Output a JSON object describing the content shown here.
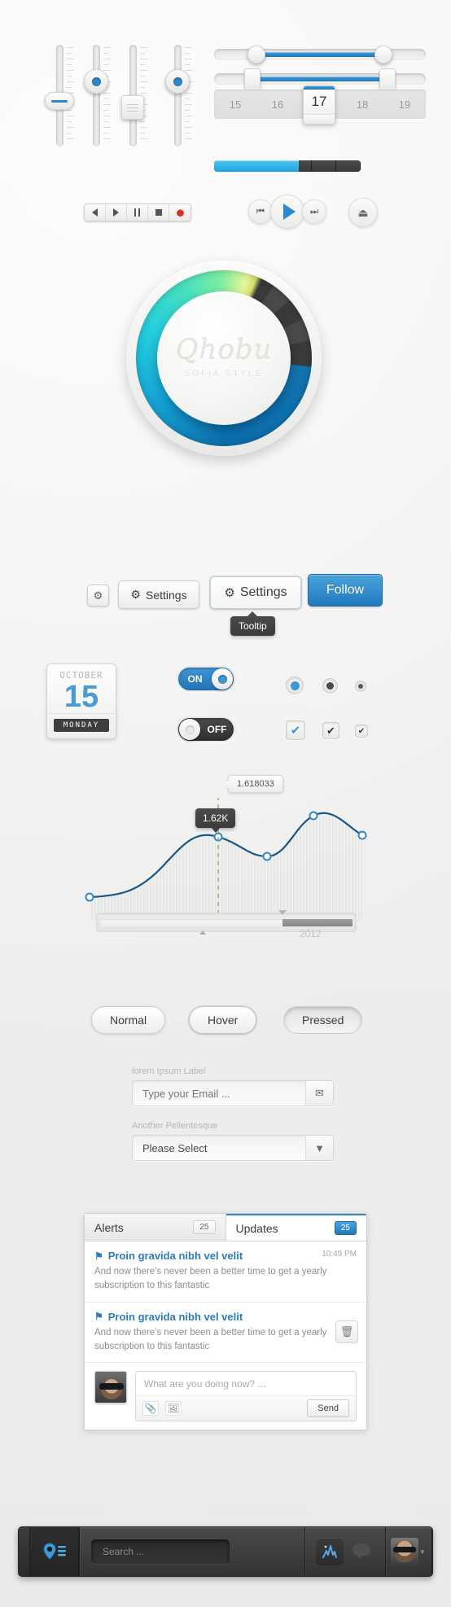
{
  "meta": {
    "accent": "#2f86c8",
    "accent_dark": "#1f79bf",
    "bg": "#f0f0ef"
  },
  "sliders": {
    "vertical": [
      {
        "name": "flat-handle",
        "value": 52
      },
      {
        "name": "round-handle-upper",
        "value": 72
      },
      {
        "name": "square-handle",
        "value": 38
      },
      {
        "name": "round-handle-lower",
        "value": 72
      }
    ],
    "horizontal": [
      {
        "name": "range-round",
        "low": 20,
        "high": 78
      },
      {
        "name": "range-pin",
        "low": 18,
        "high": 82
      }
    ]
  },
  "stepper": {
    "values": [
      "15",
      "16",
      "18",
      "19"
    ],
    "selected": "17"
  },
  "progress": {
    "percent": 58,
    "segments": 6
  },
  "transport": {
    "buttons": [
      {
        "name": "rewind",
        "icon": "triangle-left-icon"
      },
      {
        "name": "play",
        "icon": "triangle-right-icon"
      },
      {
        "name": "pause",
        "icon": "pause-icon"
      },
      {
        "name": "stop",
        "icon": "stop-icon"
      },
      {
        "name": "record",
        "icon": "record-icon"
      }
    ]
  },
  "round_transport": {
    "prev": "⏮",
    "play": "▶",
    "next": "⏭",
    "eject": "⏏"
  },
  "dial": {
    "brand": "Qhobu",
    "subtitle": "SOFIA STYLE"
  },
  "action_buttons": {
    "gear_only_label": "",
    "settings_normal": "Settings",
    "settings_hover": "Settings",
    "follow": "Follow",
    "tooltip": "Tooltip",
    "gear_icon": "gear-icon"
  },
  "calendar": {
    "month": "OCTOBER",
    "day": "15",
    "weekday": "MONDAY"
  },
  "toggles": [
    {
      "name": "toggle-on",
      "label": "ON",
      "state": "on"
    },
    {
      "name": "toggle-off",
      "label": "OFF",
      "state": "off"
    }
  ],
  "radios": [
    {
      "name": "radio-blue",
      "color": "#3f97d4",
      "size": "large"
    },
    {
      "name": "radio-dark",
      "color": "#4a4a4a",
      "size": "medium"
    },
    {
      "name": "radio-small",
      "color": "#5a5a5a",
      "size": "small"
    }
  ],
  "checkboxes": [
    {
      "name": "checkbox-blue",
      "mark": "✔",
      "color": "#3f97d4",
      "size": "large"
    },
    {
      "name": "checkbox-dark",
      "mark": "✔",
      "color": "#333333",
      "size": "medium"
    },
    {
      "name": "checkbox-small",
      "mark": "✔",
      "color": "#333333",
      "size": "small"
    }
  ],
  "chart_data": {
    "type": "line",
    "title": "",
    "xlabel": "",
    "ylabel": "",
    "x": [
      0,
      1,
      2,
      3,
      4,
      5
    ],
    "values": [
      620,
      700,
      1620,
      1460,
      2180,
      1840
    ],
    "point_labels": [
      "",
      "",
      "1.62K",
      "",
      "",
      ""
    ],
    "tooltip_value": "1.62K",
    "callout_value": "1.618033",
    "axis_tick_label": "2012",
    "xlim": [
      0,
      5
    ],
    "ylim": [
      0,
      2600
    ],
    "grid": true,
    "legend": "none",
    "marker_points": [
      0,
      2,
      3,
      4,
      5
    ],
    "range_selector": {
      "start": 0,
      "end": 78,
      "year": "2012"
    }
  },
  "pill_buttons": [
    {
      "name": "button-normal",
      "label": "Normal",
      "state": "normal"
    },
    {
      "name": "button-hover",
      "label": "Hover",
      "state": "hover"
    },
    {
      "name": "button-pressed",
      "label": "Pressed",
      "state": "pressed"
    }
  ],
  "form": {
    "email_label": "lorem Ipsum Label",
    "email_placeholder": "Type your Email ...",
    "email_value": "",
    "email_icon": "envelope-icon",
    "select_label": "Another Pellentesque",
    "select_value": "Please Select",
    "select_icon": "chevron-down-icon"
  },
  "notifications": {
    "tabs": [
      {
        "name": "tab-alerts",
        "label": "Alerts",
        "count": "25",
        "active": false
      },
      {
        "name": "tab-updates",
        "label": "Updates",
        "count": "25",
        "active": true
      }
    ],
    "items": [
      {
        "icon": "flag-icon",
        "title": "Proin gravida nibh vel velit",
        "time": "10:49 PM",
        "body": "And now there's never been a better time to get a yearly subscription to this fantastic",
        "has_delete": false
      },
      {
        "icon": "flag-icon",
        "title": "Proin gravida nibh vel velit",
        "time": "",
        "body": "And now there's never been a better time to get a yearly subscription to this fantastic",
        "has_delete": true,
        "delete_icon": "trash-icon"
      }
    ],
    "composer": {
      "placeholder": "What are you doing now? ...",
      "attach_icon": "paperclip-icon",
      "image_icon": "image-icon",
      "send_label": "Send",
      "avatar": "avatar"
    }
  },
  "dock": {
    "logo_icon": "location-list-icon",
    "search_placeholder": "Search ...",
    "tools": [
      {
        "name": "waveform-icon"
      },
      {
        "name": "chat-bubble-icon"
      }
    ],
    "photo": "user-photo",
    "caret_icon": "chevron-down-icon"
  }
}
